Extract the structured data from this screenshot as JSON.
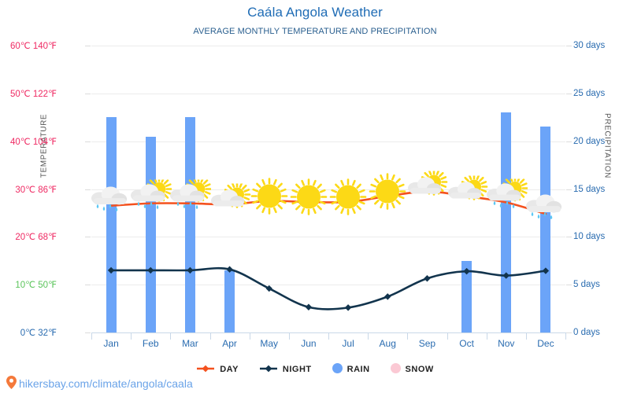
{
  "header": {
    "title": "Caála Angola Weather",
    "subtitle": "AVERAGE MONTHLY TEMPERATURE AND PRECIPITATION",
    "title_color": "#1f6cb5"
  },
  "axes": {
    "left_title": "TEMPERATURE",
    "right_title": "PRECIPITATION",
    "left_ticks": [
      {
        "label": "60℃ 140℉",
        "value": 60,
        "color": "#ef2a63"
      },
      {
        "label": "50℃ 122℉",
        "value": 50,
        "color": "#ef2a63"
      },
      {
        "label": "40℃ 104℉",
        "value": 40,
        "color": "#ef2a63"
      },
      {
        "label": "30℃ 86℉",
        "value": 30,
        "color": "#ef2a63"
      },
      {
        "label": "20℃ 68℉",
        "value": 20,
        "color": "#ef2a63"
      },
      {
        "label": "10℃ 50℉",
        "value": 10,
        "color": "#5ac45a"
      },
      {
        "label": "0℃ 32℉",
        "value": 0,
        "color": "#2a6cb0"
      }
    ],
    "right_ticks": [
      {
        "label": "30 days",
        "value": 30
      },
      {
        "label": "25 days",
        "value": 25
      },
      {
        "label": "20 days",
        "value": 20
      },
      {
        "label": "15 days",
        "value": 15
      },
      {
        "label": "10 days",
        "value": 10
      },
      {
        "label": "5 days",
        "value": 5
      },
      {
        "label": "0 days",
        "value": 0
      }
    ]
  },
  "legend": [
    {
      "label": "DAY",
      "type": "line-marker",
      "color": "#f4511e"
    },
    {
      "label": "NIGHT",
      "type": "line-marker",
      "color": "#12344d"
    },
    {
      "label": "RAIN",
      "type": "dot",
      "color": "#6ba4f8"
    },
    {
      "label": "SNOW",
      "type": "dot",
      "color": "#fbc9d4"
    }
  ],
  "footer": {
    "url": "hikersbay.com/climate/angola/caala",
    "pin_icon": "location-pin-icon",
    "color": "#6aa3e8"
  },
  "chart_data": {
    "type": "line",
    "title": "Caála Angola Weather",
    "subtitle": "AVERAGE MONTHLY TEMPERATURE AND PRECIPITATION",
    "xlabel": "",
    "ylabel": "TEMPERATURE",
    "y2label": "PRECIPITATION",
    "ylim": [
      0,
      60
    ],
    "y2lim": [
      0,
      30
    ],
    "grid": true,
    "legend_position": "bottom",
    "categories": [
      "Jan",
      "Feb",
      "Mar",
      "Apr",
      "May",
      "Jun",
      "Jul",
      "Aug",
      "Sep",
      "Oct",
      "Nov",
      "Dec"
    ],
    "series": [
      {
        "name": "DAY",
        "type": "line",
        "axis": "left",
        "unit": "℃",
        "color": "#f4511e",
        "values": [
          26.5,
          27.0,
          27.0,
          26.8,
          27.5,
          27.3,
          27.3,
          28.5,
          29.5,
          28.5,
          27.2,
          24.8
        ]
      },
      {
        "name": "NIGHT",
        "type": "line",
        "axis": "left",
        "unit": "℃",
        "color": "#12344d",
        "values": [
          13.0,
          13.0,
          13.0,
          13.2,
          9.2,
          5.3,
          5.2,
          7.5,
          11.3,
          12.8,
          11.9,
          12.9
        ]
      },
      {
        "name": "RAIN",
        "type": "bar",
        "axis": "right",
        "unit": "days",
        "color": "#6ba4f8",
        "values": [
          22.5,
          20.5,
          22.5,
          6.5,
          0,
          0,
          0,
          0,
          0,
          7.5,
          23.0,
          21.5
        ]
      },
      {
        "name": "SNOW",
        "type": "bar",
        "axis": "right",
        "unit": "days",
        "color": "#fbc9d4",
        "values": [
          0,
          0,
          0,
          0,
          0,
          0,
          0,
          0,
          0,
          0,
          0,
          0
        ]
      }
    ],
    "weather_icons": [
      {
        "month": "Jan",
        "icon": "rain-cloud-icon"
      },
      {
        "month": "Feb",
        "icon": "sun-behind-rain-cloud-icon"
      },
      {
        "month": "Mar",
        "icon": "sun-behind-rain-cloud-icon"
      },
      {
        "month": "Apr",
        "icon": "sun-behind-cloud-icon"
      },
      {
        "month": "May",
        "icon": "sun-icon"
      },
      {
        "month": "Jun",
        "icon": "sun-icon"
      },
      {
        "month": "Jul",
        "icon": "sun-icon"
      },
      {
        "month": "Aug",
        "icon": "sun-icon"
      },
      {
        "month": "Sep",
        "icon": "sun-behind-cloud-icon"
      },
      {
        "month": "Oct",
        "icon": "sun-behind-cloud-icon"
      },
      {
        "month": "Nov",
        "icon": "sun-behind-rain-cloud-icon"
      },
      {
        "month": "Dec",
        "icon": "rain-cloud-icon"
      }
    ]
  }
}
